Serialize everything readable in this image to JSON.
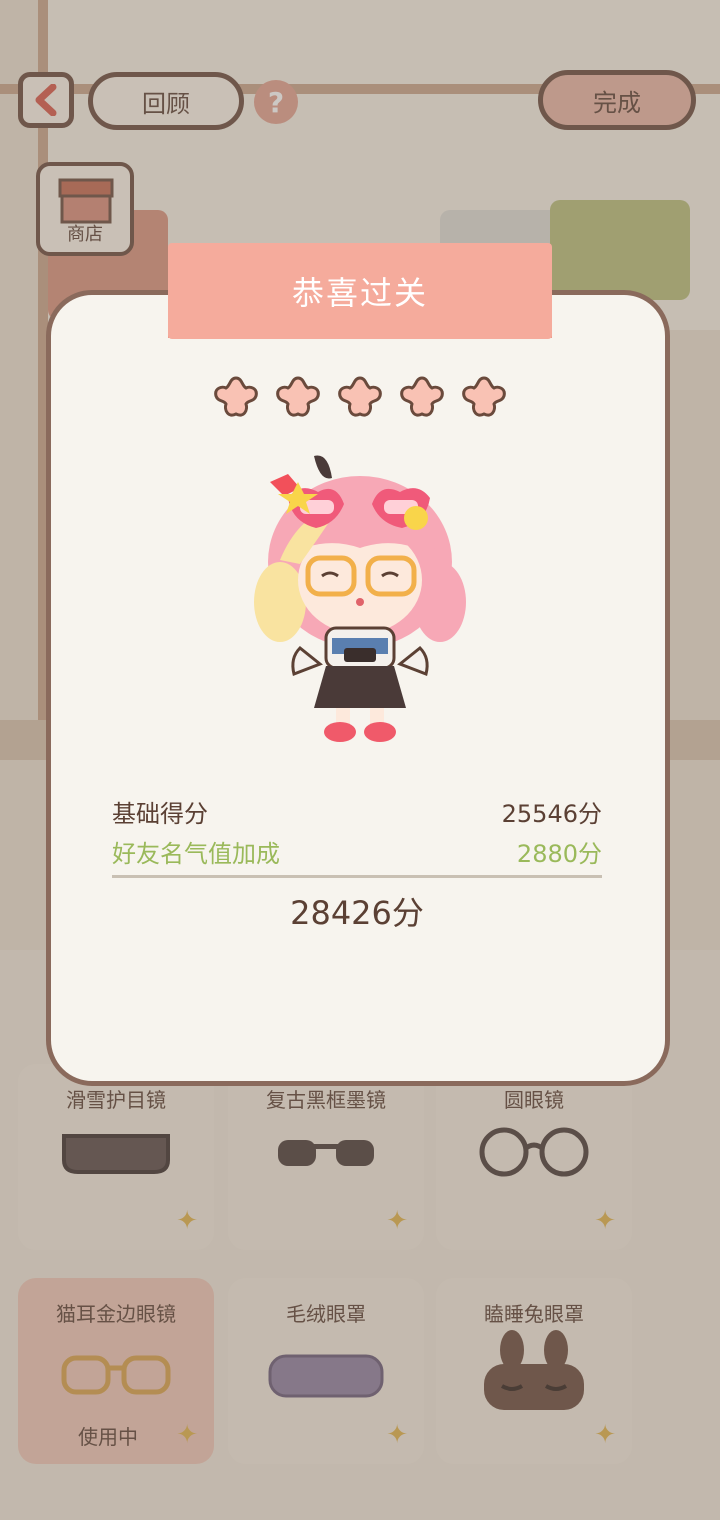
{
  "topbar": {
    "review_label": "回顾",
    "help_symbol": "?",
    "done_label": "完成",
    "shop_label": "商店"
  },
  "items": [
    {
      "label": "滑雪护目镜",
      "status": "",
      "icon": "ski-goggles-icon"
    },
    {
      "label": "复古黑框墨镜",
      "status": "",
      "icon": "black-sunglasses-icon"
    },
    {
      "label": "圆眼镜",
      "status": "",
      "icon": "round-glasses-icon"
    },
    {
      "label": "猫耳金边眼镜",
      "status": "使用中",
      "icon": "cat-ear-glasses-icon"
    },
    {
      "label": "毛绒眼罩",
      "status": "",
      "icon": "plush-eye-mask-icon"
    },
    {
      "label": "瞌睡兔眼罩",
      "status": "",
      "icon": "bunny-eye-mask-icon"
    }
  ],
  "dialog": {
    "title": "恭喜过关",
    "stars": 5,
    "base_score_label": "基础得分",
    "base_score_value": "25546分",
    "bonus_label": "好友名气值加成",
    "bonus_value": "2880分",
    "total_value": "28426分"
  },
  "colors": {
    "ribbon": "#f5ab9c",
    "bonus_text": "#9ab95a",
    "text": "#5b4034",
    "star": "#f9c2b4"
  }
}
